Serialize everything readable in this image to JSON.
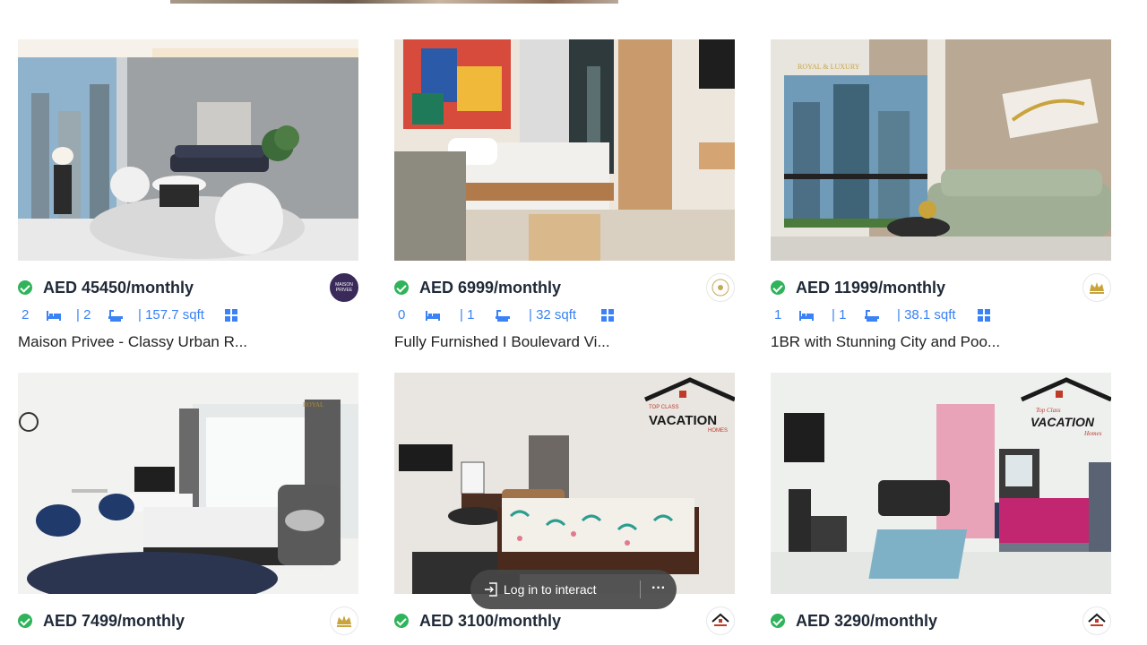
{
  "listings": [
    {
      "price": "AED 45450/monthly",
      "beds": "2",
      "baths": "| 2",
      "area": "| 157.7 sqft",
      "title": "Maison Privee - Classy Urban R...",
      "agency": "MAISON PRIVEE"
    },
    {
      "price": "AED 6999/monthly",
      "beds": "0",
      "baths": "| 1",
      "area": "| 32 sqft",
      "title": "Fully Furnished I Boulevard Vi..."
    },
    {
      "price": "AED 11999/monthly",
      "beds": "1",
      "baths": "| 1",
      "area": "| 38.1 sqft",
      "title": "1BR with Stunning City and Poo...",
      "photo_brand": "ROYAL & LUXURY"
    },
    {
      "price": "AED 7499/monthly"
    },
    {
      "price": "AED 3100/monthly",
      "photo_brand_top": "TOP CLASS",
      "photo_brand_main": "VACATION",
      "photo_brand_sub": "HOMES"
    },
    {
      "price": "AED 3290/monthly",
      "photo_brand_top": "Top Class",
      "photo_brand_main": "VACATION",
      "photo_brand_sub": "Homes"
    }
  ],
  "login_prompt": {
    "label": "Log in to interact",
    "more": "···"
  },
  "colors": {
    "accent": "#3b82f6",
    "verified": "#2fb35b",
    "text": "#1f2937"
  }
}
